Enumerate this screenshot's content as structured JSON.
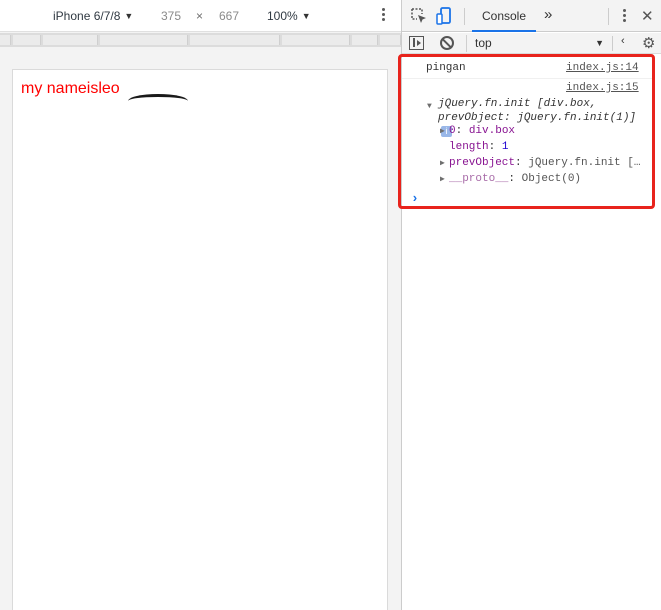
{
  "device_toolbar": {
    "device": "iPhone 6/7/8",
    "width": "375",
    "times": "×",
    "height": "667",
    "zoom": "100%"
  },
  "page": {
    "text": "my nameisleo"
  },
  "devtools": {
    "tabs": {
      "console": "Console",
      "more": "»"
    },
    "close_glyph": "✕",
    "context": "top",
    "chevron": "‹",
    "gear_glyph": "⚙",
    "messages": {
      "pingan": "pingan",
      "pingan_source": "index.js:14",
      "object_source": "index.js:15",
      "object_head": "jQuery.fn.init [div.box, prevObject: jQuery.fn.init(1)]",
      "info_badge": "i",
      "props": {
        "p0_key": "0",
        "p0_val": "div.box",
        "length_key": "length",
        "length_val": "1",
        "prev_key": "prevObject",
        "prev_val": "jQuery.fn.init […",
        "proto_key": "__proto__",
        "proto_val": "Object(0)"
      }
    },
    "prompt_glyph": "›"
  },
  "colors": {
    "page_text": "#ff0000",
    "highlight": "#e8231c",
    "active_tab": "#1a73e8"
  }
}
